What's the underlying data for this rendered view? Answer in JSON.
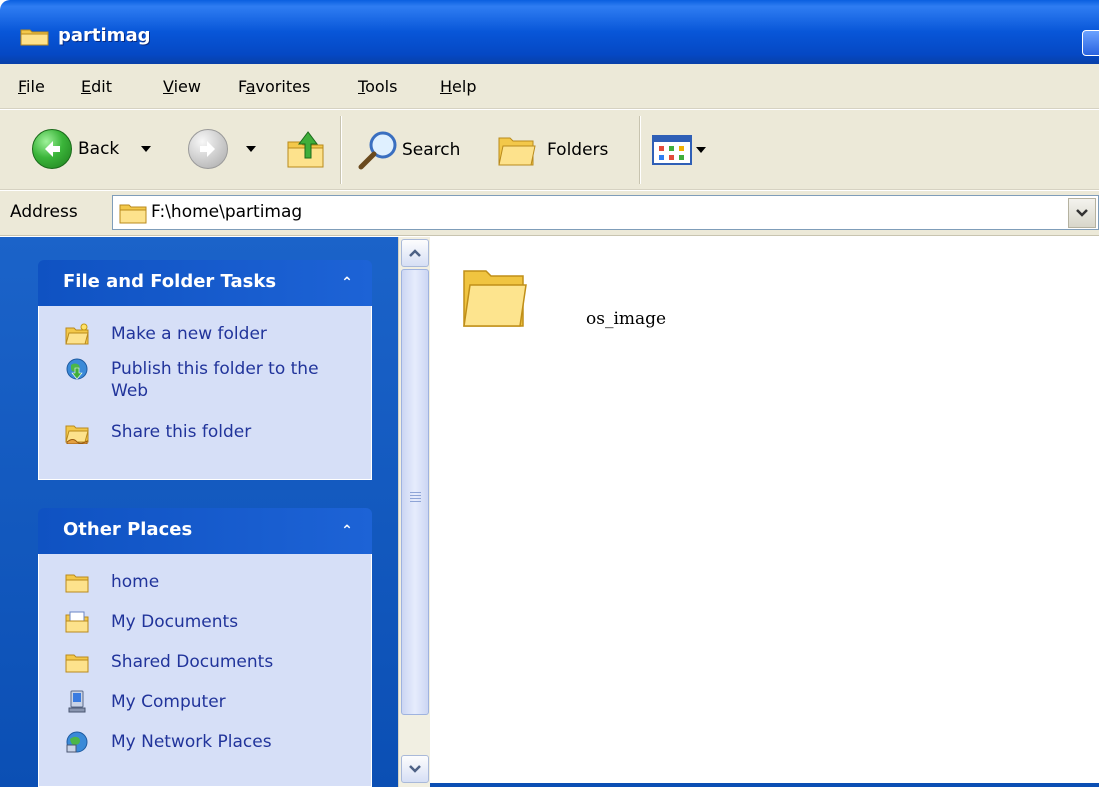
{
  "window": {
    "title": "partimag"
  },
  "menu": [
    {
      "label": "File",
      "accel": "F"
    },
    {
      "label": "Edit",
      "accel": "E"
    },
    {
      "label": "View",
      "accel": "V"
    },
    {
      "label": "Favorites",
      "accel": "a"
    },
    {
      "label": "Tools",
      "accel": "T"
    },
    {
      "label": "Help",
      "accel": "H"
    }
  ],
  "toolbar": {
    "back_label": "Back",
    "search_label": "Search",
    "folders_label": "Folders"
  },
  "address": {
    "label": "Address",
    "value": "F:\\home\\partimag"
  },
  "tasks_panel": {
    "title": "File and Folder Tasks",
    "items": [
      {
        "label": "Make a new folder",
        "icon": "new-folder-icon"
      },
      {
        "label": "Publish this folder to the Web",
        "icon": "publish-web-icon"
      },
      {
        "label": "Share this folder",
        "icon": "share-folder-icon"
      }
    ]
  },
  "places_panel": {
    "title": "Other Places",
    "items": [
      {
        "label": "home",
        "icon": "folder-icon"
      },
      {
        "label": "My Documents",
        "icon": "my-documents-icon"
      },
      {
        "label": "Shared Documents",
        "icon": "folder-icon"
      },
      {
        "label": "My Computer",
        "icon": "my-computer-icon"
      },
      {
        "label": "My Network Places",
        "icon": "network-places-icon"
      }
    ]
  },
  "files": [
    {
      "name": "os_image",
      "type": "folder"
    }
  ],
  "colors": {
    "titlebar": "#0856d8",
    "taskpane": "#0b4fb4",
    "panel_body": "#d6dff7",
    "task_link": "#21349b",
    "chrome": "#ece9d8"
  }
}
